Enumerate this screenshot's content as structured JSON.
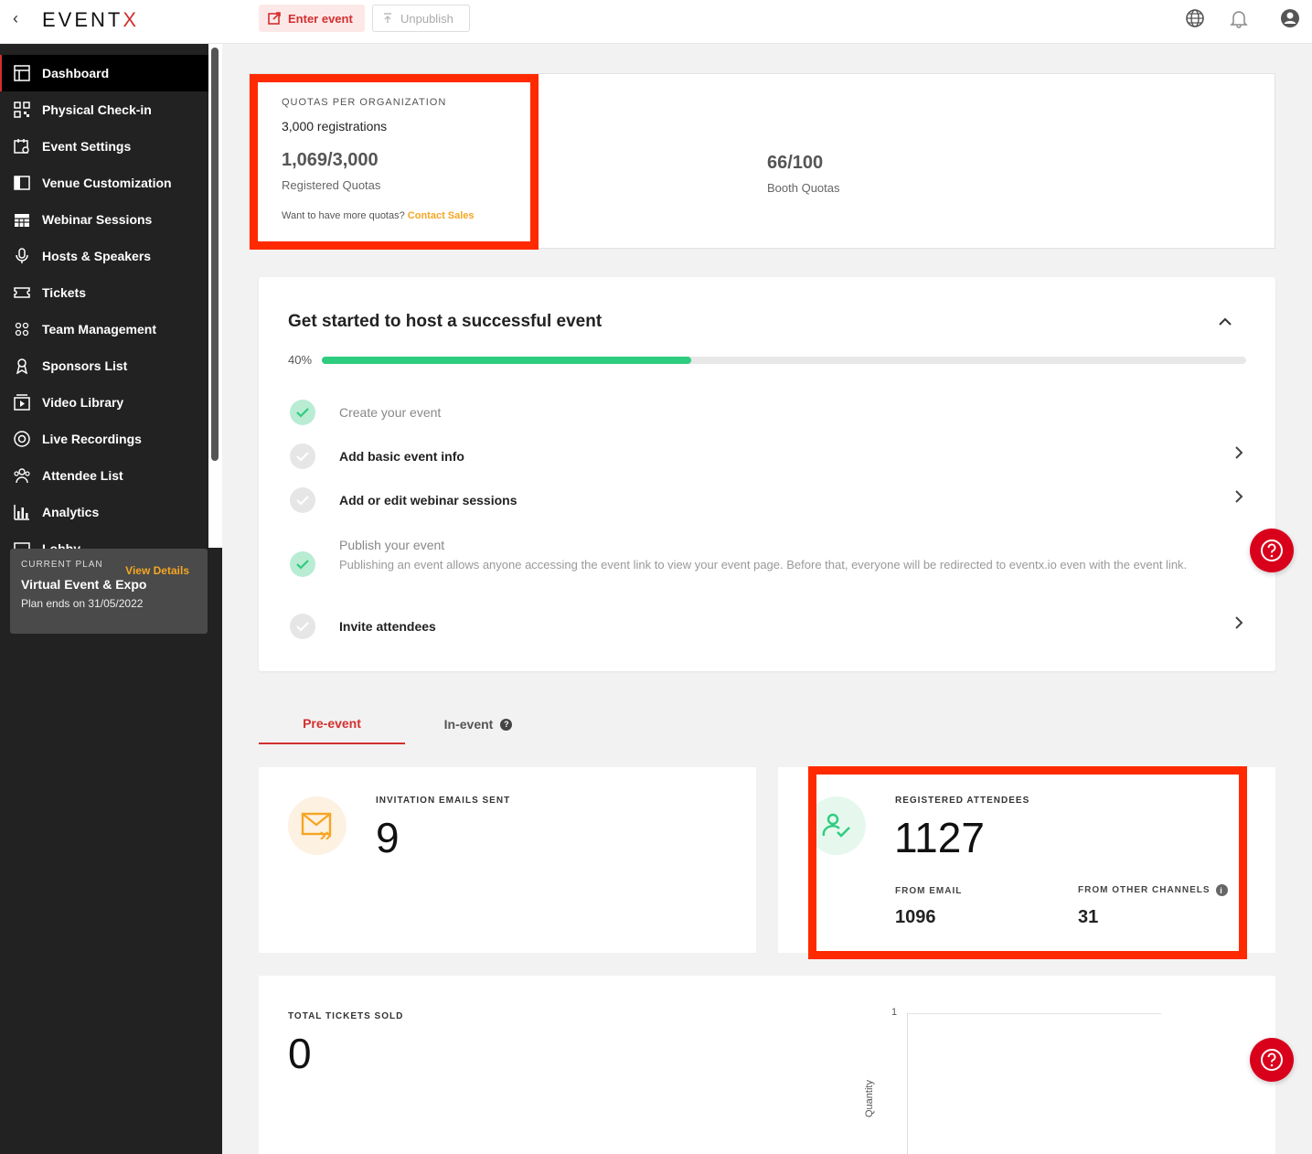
{
  "header": {
    "logo_text": "EVENTX",
    "enter_event_label": "Enter event",
    "unpublish_label": "Unpublish"
  },
  "sidebar": {
    "items": [
      {
        "label": "Dashboard",
        "icon": "dashboard-icon"
      },
      {
        "label": "Physical Check-in",
        "icon": "qr-code-icon"
      },
      {
        "label": "Event Settings",
        "icon": "calendar-settings-icon"
      },
      {
        "label": "Venue Customization",
        "icon": "layout-icon"
      },
      {
        "label": "Webinar Sessions",
        "icon": "grid-calendar-icon"
      },
      {
        "label": "Hosts & Speakers",
        "icon": "microphone-icon"
      },
      {
        "label": "Tickets",
        "icon": "ticket-icon"
      },
      {
        "label": "Team Management",
        "icon": "team-icon"
      },
      {
        "label": "Sponsors List",
        "icon": "sponsor-icon"
      },
      {
        "label": "Video Library",
        "icon": "video-library-icon"
      },
      {
        "label": "Live Recordings",
        "icon": "record-icon"
      },
      {
        "label": "Attendee List",
        "icon": "attendees-icon"
      },
      {
        "label": "Analytics",
        "icon": "bar-chart-icon"
      },
      {
        "label": "Lobby",
        "icon": "lobby-icon"
      }
    ],
    "plan": {
      "label": "CURRENT PLAN",
      "link": "View Details",
      "name": "Virtual Event & Expo",
      "ends": "Plan ends on 31/05/2022"
    }
  },
  "quotas": {
    "title": "QUOTAS PER ORGANIZATION",
    "subtitle": "3,000 registrations",
    "registered_value": "1,069/3,000",
    "registered_label": "Registered Quotas",
    "booth_value": "66/100",
    "booth_label": "Booth Quotas",
    "more_text": "Want to have more quotas?",
    "contact_link": "Contact Sales"
  },
  "get_started": {
    "title": "Get started to host a successful event",
    "progress_label": "40%",
    "progress_fraction": 0.4,
    "steps": [
      {
        "label": "Create your event",
        "done": true
      },
      {
        "label": "Add basic event info",
        "done": false
      },
      {
        "label": "Add or edit webinar sessions",
        "done": false
      },
      {
        "label": "Publish your event",
        "done": true,
        "description": "Publishing an event allows anyone accessing the event link to view your event page. Before that, everyone will be redirected to eventx.io even with the event link."
      },
      {
        "label": "Invite attendees",
        "done": false
      }
    ]
  },
  "tabs": {
    "pre_event": "Pre-event",
    "in_event": "In-event"
  },
  "stats": {
    "invitation_label": "INVITATION EMAILS SENT",
    "invitation_value": "9",
    "registered_label": "REGISTERED ATTENDEES",
    "registered_value": "1127",
    "from_email_label": "FROM EMAIL",
    "from_email_value": "1096",
    "from_other_label": "FROM OTHER CHANNELS",
    "from_other_value": "31",
    "tickets_label": "TOTAL TICKETS SOLD",
    "tickets_value": "0"
  },
  "chart": {
    "y_tick": "1",
    "y_label": "Quantity"
  },
  "colors": {
    "accent": "#d32f2f",
    "highlight": "#ff2a00",
    "progress": "#2ecc7e",
    "link": "#f5a623"
  }
}
